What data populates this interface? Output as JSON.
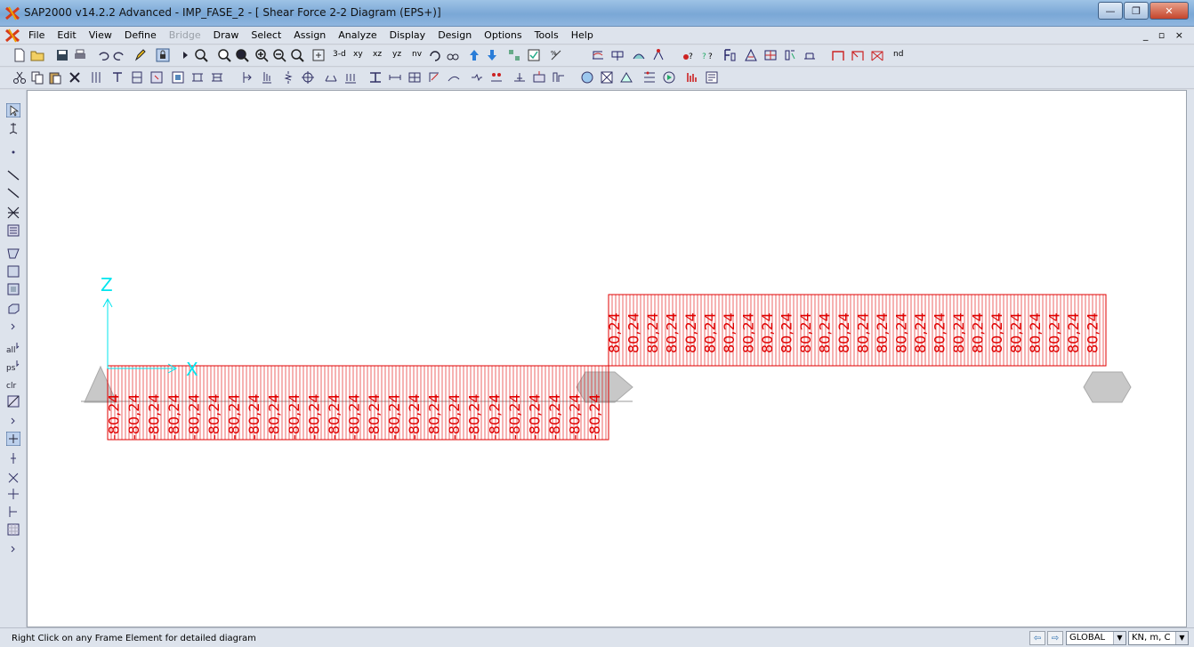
{
  "window": {
    "title": "SAP2000 v14.2.2 Advanced  - IMP_FASE_2 - [  Shear Force 2-2 Diagram  (EPS+)]",
    "min_label": "—",
    "max_label": "❐",
    "close_label": "✕"
  },
  "menu": {
    "items": [
      {
        "label": "File"
      },
      {
        "label": "Edit"
      },
      {
        "label": "View"
      },
      {
        "label": "Define"
      },
      {
        "label": "Bridge",
        "disabled": true
      },
      {
        "label": "Draw"
      },
      {
        "label": "Select"
      },
      {
        "label": "Assign"
      },
      {
        "label": "Analyze"
      },
      {
        "label": "Display"
      },
      {
        "label": "Design"
      },
      {
        "label": "Options"
      },
      {
        "label": "Tools"
      },
      {
        "label": "Help"
      }
    ],
    "mdi_controls": "_ ▫ ×"
  },
  "toolbar": {
    "view_3d": "3-d",
    "view_xy": "xy",
    "view_xz": "xz",
    "view_yz": "yz",
    "view_nv": "nv",
    "nd_label": "nd"
  },
  "diagram": {
    "axis_z": "Z",
    "axis_x": "X",
    "negative_value": "-80,24",
    "positive_value": "80,24",
    "colors": {
      "diagram": "#e00000",
      "axes": "#00e5ee",
      "support": "#c8c8c8"
    }
  },
  "status": {
    "message": "Right Click on any Frame Element for detailed diagram",
    "coord_system": "GLOBAL",
    "units": "KN, m, C"
  }
}
